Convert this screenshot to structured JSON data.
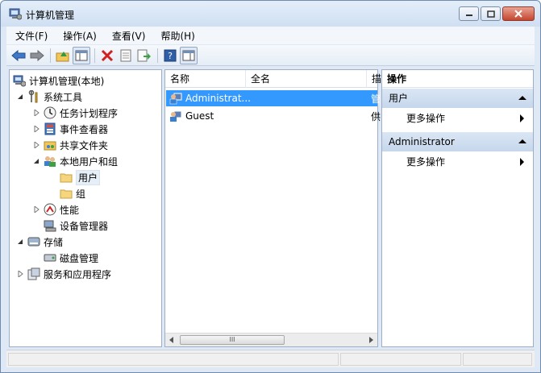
{
  "window": {
    "title": "计算机管理"
  },
  "menu": [
    "文件(F)",
    "操作(A)",
    "查看(V)",
    "帮助(H)"
  ],
  "toolbar": {
    "icons": [
      "back-arrow-icon",
      "forward-arrow-icon",
      "up-folder-icon",
      "show-hide-tree-icon",
      "delete-icon",
      "properties-icon",
      "export-list-icon",
      "help-icon",
      "show-hide-action-pane-icon"
    ]
  },
  "tree": {
    "root": "计算机管理(本地)",
    "system_tools": "系统工具",
    "task_scheduler": "任务计划程序",
    "event_viewer": "事件查看器",
    "shared_folders": "共享文件夹",
    "local_users_groups": "本地用户和组",
    "users": "用户",
    "groups": "组",
    "performance": "性能",
    "device_manager": "设备管理器",
    "storage": "存储",
    "disk_management": "磁盘管理",
    "services_apps": "服务和应用程序"
  },
  "list": {
    "columns": [
      "名称",
      "全名",
      "描"
    ],
    "rows": [
      {
        "name": "Administrat...",
        "extra": "管",
        "selected": true
      },
      {
        "name": "Guest",
        "extra": "供",
        "selected": false
      }
    ],
    "scroll_thumb": "III"
  },
  "actions": {
    "title": "操作",
    "section1": "用户",
    "section1_item": "更多操作",
    "section2": "Administrator",
    "section2_item": "更多操作"
  },
  "colors": {
    "selection": "#3399ff",
    "section_bg": "#c6d7ec"
  }
}
